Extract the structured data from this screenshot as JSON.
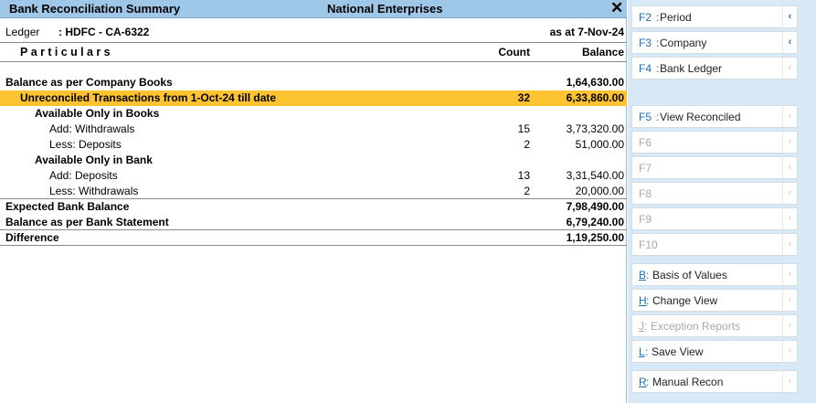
{
  "title_bar": {
    "report_title": "Bank Reconciliation Summary",
    "company": "National Enterprises",
    "close_glyph": "✕"
  },
  "ledger": {
    "label": "Ledger",
    "value": ": HDFC - CA-6322",
    "as_at": "as at 7-Nov-24"
  },
  "columns": {
    "particulars": "Particulars",
    "count": "Count",
    "balance": "Balance"
  },
  "rows": [
    {
      "name": "Balance as per Company Books",
      "count": "",
      "balance": "1,64,630.00"
    },
    {
      "name": "Unreconciled Transactions from 1-Oct-24 till date",
      "count": "32",
      "balance": "6,33,860.00"
    },
    {
      "name": "Available Only in Books",
      "count": "",
      "balance": ""
    },
    {
      "name": "Add: Withdrawals",
      "count": "15",
      "balance": "3,73,320.00"
    },
    {
      "name": "Less: Deposits",
      "count": "2",
      "balance": "51,000.00"
    },
    {
      "name": "Available Only in Bank",
      "count": "",
      "balance": ""
    },
    {
      "name": "Add: Deposits",
      "count": "13",
      "balance": "3,31,540.00"
    },
    {
      "name": "Less: Withdrawals",
      "count": "2",
      "balance": "20,000.00"
    },
    {
      "name": "Expected Bank Balance",
      "count": "",
      "balance": "7,98,490.00"
    },
    {
      "name": "Balance as per Bank Statement",
      "count": "",
      "balance": "6,79,240.00"
    },
    {
      "name": "Difference",
      "count": "",
      "balance": "1,19,250.00"
    }
  ],
  "side_panel": {
    "chevron_glyph": "‹",
    "buttons": [
      {
        "key": "F2",
        "label": "Period"
      },
      {
        "key": "F3",
        "label": "Company"
      },
      {
        "key": "F4",
        "label": "Bank Ledger"
      },
      {
        "key": "F5",
        "label": "View Reconciled"
      },
      {
        "key": "F6",
        "label": ""
      },
      {
        "key": "F7",
        "label": ""
      },
      {
        "key": "F8",
        "label": ""
      },
      {
        "key": "F9",
        "label": ""
      },
      {
        "key": "F10",
        "label": ""
      },
      {
        "key": "B",
        "label": "Basis of Values"
      },
      {
        "key": "H",
        "label": "Change View"
      },
      {
        "key": "J",
        "label": "Exception Reports"
      },
      {
        "key": "L",
        "label": "Save View"
      },
      {
        "key": "R",
        "label": "Manual Recon"
      }
    ]
  },
  "colors": {
    "title_bar": "#9fc8e8",
    "highlight_row": "#fdc331",
    "side_panel": "#d7e9f7",
    "key_accent": "#1c6fb6"
  }
}
